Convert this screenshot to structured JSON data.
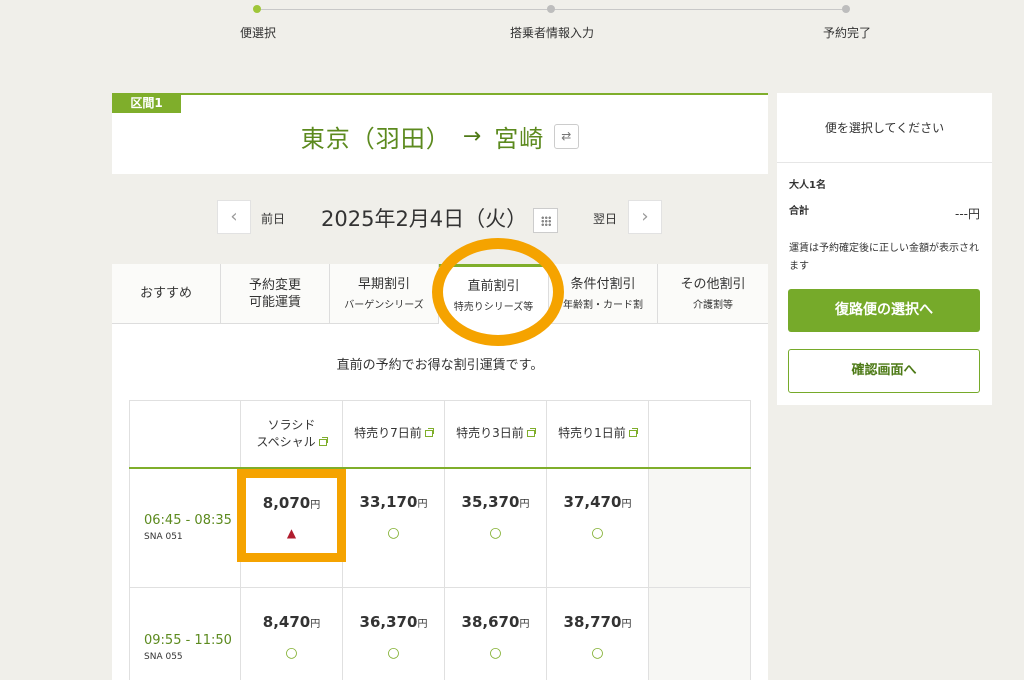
{
  "steps": [
    {
      "label": "便選択",
      "active": true
    },
    {
      "label": "搭乗者情報入力",
      "active": false
    },
    {
      "label": "予約完了",
      "active": false
    }
  ],
  "route": {
    "section_tag": "区間1",
    "from": "東京（羽田）",
    "arrow": "→",
    "to": "宮崎",
    "swap_icon": "⇄"
  },
  "date_nav": {
    "prev_label": "前日",
    "date": "2025年2月4日（火）",
    "next_label": "翌日",
    "prev_icon": "‹",
    "next_icon": "›"
  },
  "tabs": [
    {
      "main": "おすすめ",
      "sub": "",
      "active": false
    },
    {
      "main": "予約変更\n可能運賃",
      "sub": "",
      "active": false
    },
    {
      "main": "早期割引",
      "sub": "バーゲンシリーズ",
      "active": false
    },
    {
      "main": "直前割引",
      "sub": "特売りシリーズ等",
      "active": true
    },
    {
      "main": "条件付割引",
      "sub": "年齢割・カード割",
      "active": false
    },
    {
      "main": "その他割引",
      "sub": "介護割等",
      "active": false
    }
  ],
  "description": "直前の予約でお得な割引運賃です。",
  "fare_columns": [
    "ソラシド\nスペシャル",
    "特売り7日前",
    "特売り3日前",
    "特売り1日前"
  ],
  "flights": [
    {
      "time": "06:45 - 08:35",
      "flight_no": "SNA 051",
      "fares": [
        {
          "price": "8,070",
          "unit": "円",
          "status": "▲",
          "status_type": "low"
        },
        {
          "price": "33,170",
          "unit": "円",
          "status": "○",
          "status_type": "ok"
        },
        {
          "price": "35,370",
          "unit": "円",
          "status": "○",
          "status_type": "ok"
        },
        {
          "price": "37,470",
          "unit": "円",
          "status": "○",
          "status_type": "ok"
        }
      ]
    },
    {
      "time": "09:55 - 11:50",
      "flight_no": "SNA 055",
      "fares": [
        {
          "price": "8,470",
          "unit": "円",
          "status": "○",
          "status_type": "ok"
        },
        {
          "price": "36,370",
          "unit": "円",
          "status": "○",
          "status_type": "ok"
        },
        {
          "price": "38,670",
          "unit": "円",
          "status": "○",
          "status_type": "ok"
        },
        {
          "price": "38,770",
          "unit": "円",
          "status": "○",
          "status_type": "ok"
        }
      ]
    }
  ],
  "summary": {
    "header": "便を選択してください",
    "passengers": "大人1名",
    "total_label": "合計",
    "total_value": "---円",
    "note": "運賃は予約確定後に正しい金額が表示されます",
    "return_button": "復路便の選択へ",
    "confirm_button": "確認画面へ"
  },
  "colors": {
    "accent": "#7fae2b",
    "highlight": "#f5a300",
    "low_availability": "#b01c2e"
  }
}
